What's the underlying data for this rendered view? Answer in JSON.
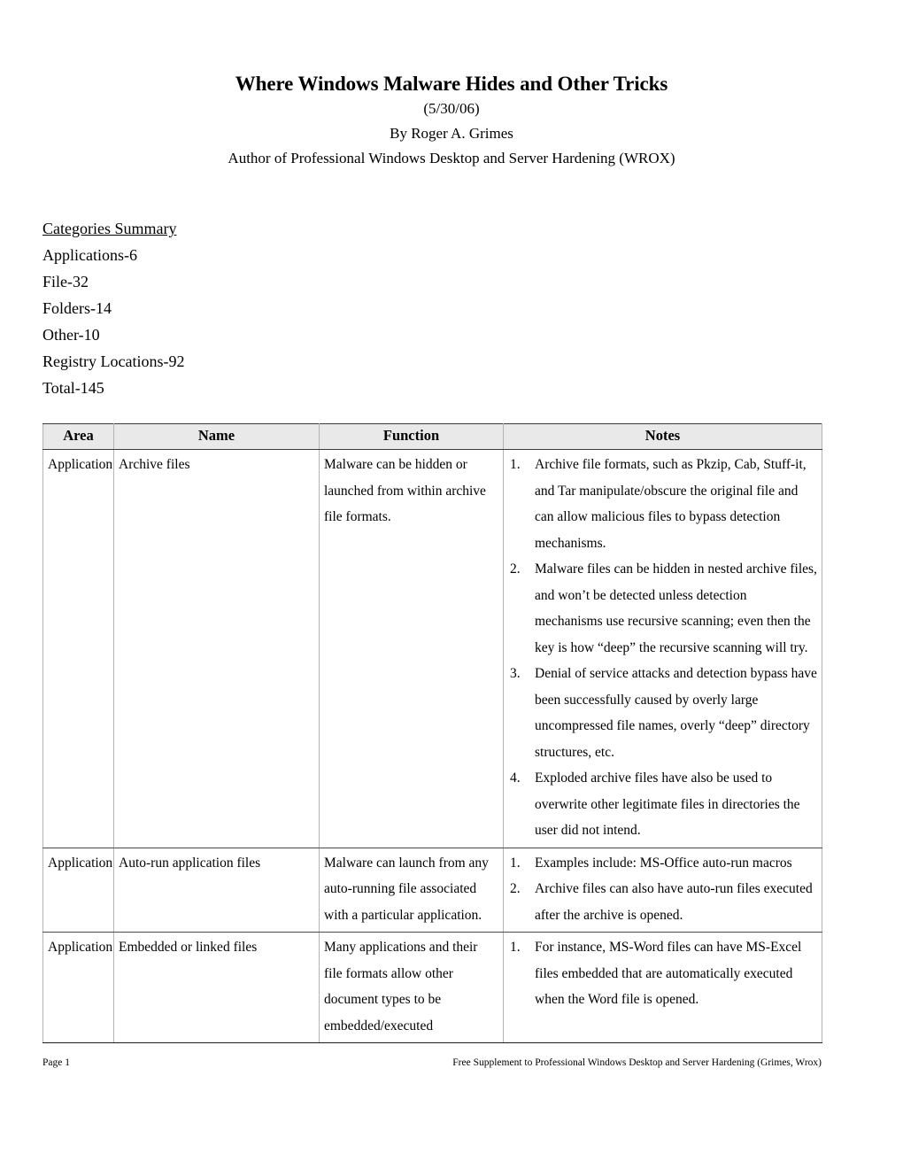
{
  "document": {
    "title": "Where Windows Malware Hides and Other Tricks",
    "date": "(5/30/06)",
    "author": "By Roger A. Grimes",
    "credit": "Author of Professional Windows Desktop and Server Hardening (WROX)"
  },
  "summary": {
    "heading": "Categories Summary",
    "lines": [
      "Applications-6",
      "File-32",
      "Folders-14",
      "Other-10",
      "Registry Locations-92",
      "Total-145"
    ]
  },
  "table": {
    "headers": [
      "Area",
      "Name",
      "Function",
      "Notes"
    ],
    "rows": [
      {
        "area": "Application",
        "name": "Archive files",
        "function": "Malware can be hidden or launched from within archive file formats.",
        "notes": [
          "Archive file formats, such as Pkzip, Cab, Stuff-it, and Tar manipulate/obscure the original file and can allow malicious files to bypass detection mechanisms.",
          "Malware files can be hidden in nested archive files, and won’t be detected unless detection mechanisms use recursive scanning; even then the key is how “deep” the recursive scanning will try.",
          "Denial of service attacks and detection bypass have been successfully caused by overly large uncompressed file names, overly “deep” directory structures, etc.",
          "Exploded archive files have also be used to overwrite other legitimate files in directories the user did not intend."
        ]
      },
      {
        "area": "Application",
        "name": "Auto-run application files",
        "function": "Malware can launch from any auto-running file associated with a particular application.",
        "notes": [
          "Examples include: MS-Office auto-run macros",
          "Archive files can also have auto-run files executed after the archive is opened."
        ]
      },
      {
        "area": "Application",
        "name": "Embedded or linked files",
        "function": "Many applications and their file formats allow other document types to be embedded/executed",
        "notes": [
          "For instance, MS-Word files can have MS-Excel files embedded that are automatically executed when the Word file is opened."
        ]
      }
    ]
  },
  "footer": {
    "page": "Page 1",
    "supplement": "Free Supplement to Professional Windows Desktop and Server Hardening (Grimes, Wrox)"
  },
  "colors": {
    "header_fill": "#e9e9e9",
    "grid_light": "#b4b4b4",
    "grid_dark": "#4a4a4a",
    "text": "#000000"
  }
}
